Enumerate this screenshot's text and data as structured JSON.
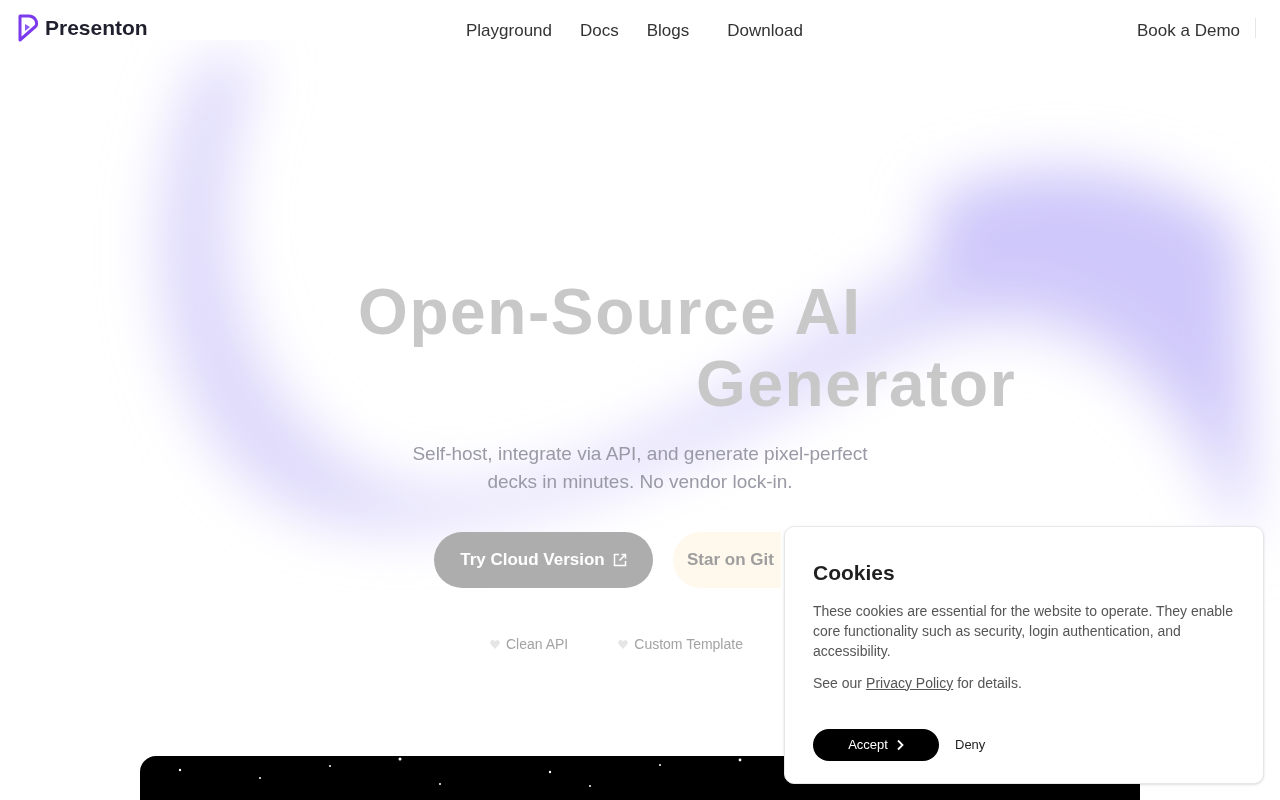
{
  "brand": {
    "name": "Presenton"
  },
  "nav": [
    {
      "label": "Playground"
    },
    {
      "label": "Docs"
    },
    {
      "label": "Blogs"
    },
    {
      "label": "Download"
    }
  ],
  "header_action": {
    "label": "Book a Demo"
  },
  "hero": {
    "title_lines": [
      "Open-Source AI",
      "Generator"
    ],
    "subtitle": "Self-host, integrate via API, and generate pixel-perfect decks in minutes. No vendor lock-in.",
    "primary_button": "Try Cloud Version",
    "secondary_button": "Star on Git",
    "features": [
      "Clean API",
      "Custom Template"
    ]
  },
  "cookie_banner": {
    "title": "Cookies",
    "body": "These cookies are essential for the website to operate. They enable core functionality such as security, login authentication, and accessibility.",
    "policy_prefix": "See our",
    "policy_link": "Privacy Policy",
    "policy_suffix": "for details.",
    "accept": "Accept",
    "deny": "Deny"
  }
}
